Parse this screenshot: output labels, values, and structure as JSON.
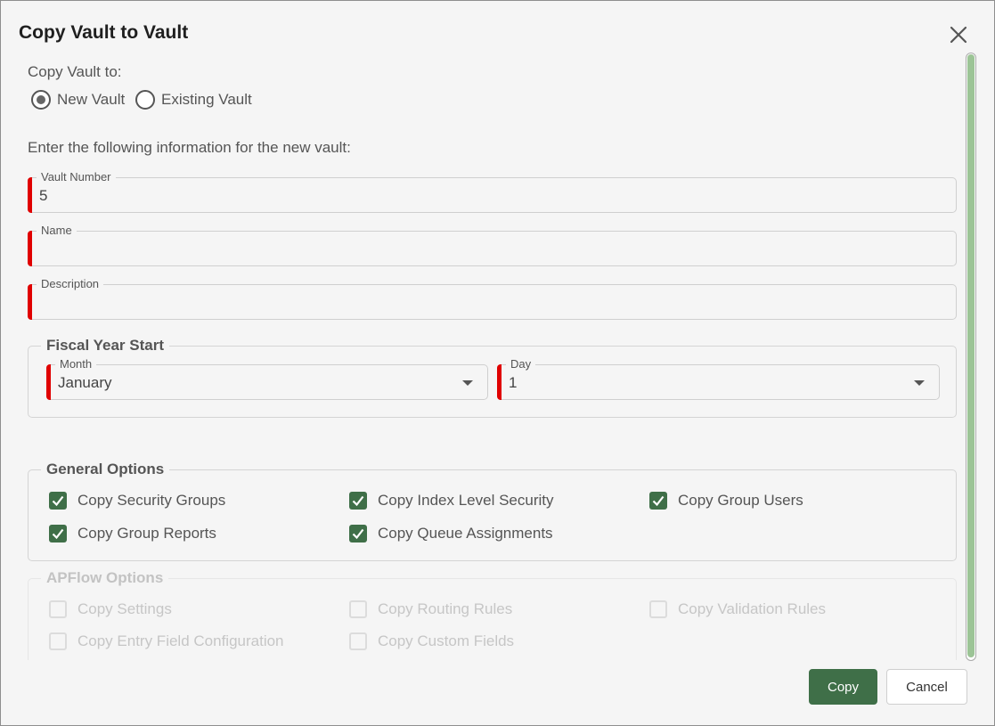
{
  "dialog": {
    "title": "Copy Vault to Vault",
    "close_icon": "close-icon"
  },
  "copy_to": {
    "label": "Copy Vault to:",
    "options": [
      {
        "label": "New Vault",
        "checked": true
      },
      {
        "label": "Existing Vault",
        "checked": false
      }
    ]
  },
  "instructions": "Enter the following information for the new vault:",
  "fields": {
    "vault_number": {
      "label": "Vault Number",
      "value": "5",
      "required": true
    },
    "name": {
      "label": "Name",
      "value": "",
      "required": true
    },
    "description": {
      "label": "Description",
      "value": "",
      "required": true
    }
  },
  "fiscal_year": {
    "legend": "Fiscal Year Start",
    "month": {
      "label": "Month",
      "value": "January"
    },
    "day": {
      "label": "Day",
      "value": "1"
    }
  },
  "general_options": {
    "legend": "General Options",
    "items": [
      {
        "label": "Copy Security Groups",
        "checked": true
      },
      {
        "label": "Copy Index Level Security",
        "checked": true
      },
      {
        "label": "Copy Group Users",
        "checked": true
      },
      {
        "label": "Copy Group Reports",
        "checked": true
      },
      {
        "label": "Copy Queue Assignments",
        "checked": true
      }
    ]
  },
  "apflow_options": {
    "legend": "APFlow Options",
    "disabled": true,
    "items": [
      {
        "label": "Copy Settings",
        "checked": false
      },
      {
        "label": "Copy Routing Rules",
        "checked": false
      },
      {
        "label": "Copy Validation Rules",
        "checked": false
      },
      {
        "label": "Copy Entry Field Configuration",
        "checked": false
      },
      {
        "label": "Copy Custom Fields",
        "checked": false
      }
    ]
  },
  "buttons": {
    "copy": "Copy",
    "cancel": "Cancel"
  },
  "colors": {
    "accent": "#3f6f48",
    "required": "#e00000",
    "scrollbar": "#9cc496"
  }
}
